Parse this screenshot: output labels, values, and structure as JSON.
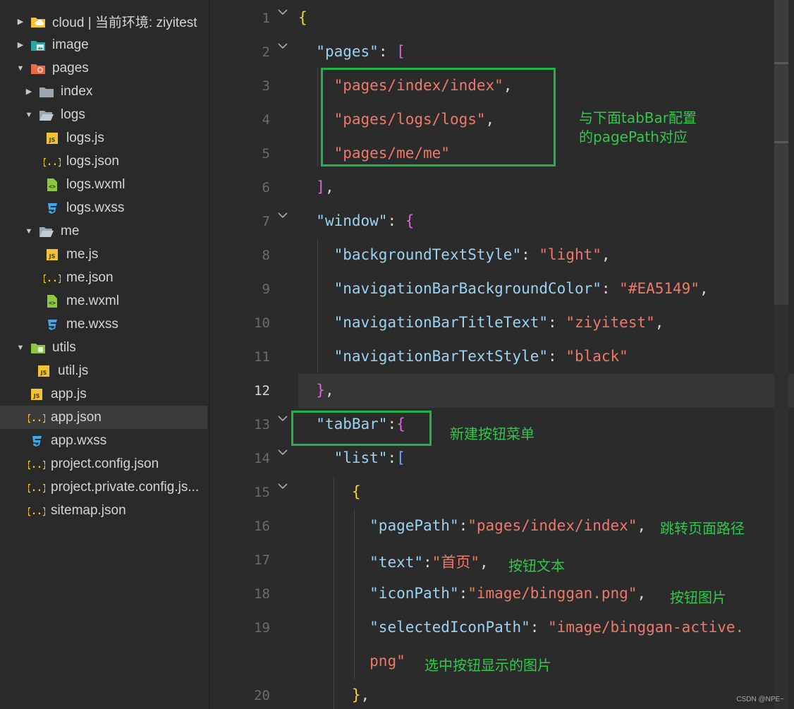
{
  "explorer": {
    "items": [
      {
        "label": "cloud | 当前环境: ziyitest",
        "icon": "cloud-folder-icon",
        "twisty": "▶"
      },
      {
        "label": "image",
        "icon": "image-folder-icon",
        "twisty": "▶"
      },
      {
        "label": "pages",
        "icon": "pages-folder-icon",
        "twisty": "▼"
      },
      {
        "label": "index",
        "icon": "folder-icon",
        "twisty": "▶"
      },
      {
        "label": "logs",
        "icon": "folder-open-icon",
        "twisty": "▼"
      },
      {
        "label": "logs.js",
        "icon": "js-file-icon",
        "twisty": ""
      },
      {
        "label": "logs.json",
        "icon": "json-file-icon",
        "twisty": ""
      },
      {
        "label": "logs.wxml",
        "icon": "wxml-file-icon",
        "twisty": ""
      },
      {
        "label": "logs.wxss",
        "icon": "wxss-file-icon",
        "twisty": ""
      },
      {
        "label": "me",
        "icon": "folder-open-icon",
        "twisty": "▼"
      },
      {
        "label": "me.js",
        "icon": "js-file-icon",
        "twisty": ""
      },
      {
        "label": "me.json",
        "icon": "json-file-icon",
        "twisty": ""
      },
      {
        "label": "me.wxml",
        "icon": "wxml-file-icon",
        "twisty": ""
      },
      {
        "label": "me.wxss",
        "icon": "wxss-file-icon",
        "twisty": ""
      },
      {
        "label": "utils",
        "icon": "utils-folder-icon",
        "twisty": "▼"
      },
      {
        "label": "util.js",
        "icon": "js-file-icon",
        "twisty": ""
      },
      {
        "label": "app.js",
        "icon": "js-file-icon",
        "twisty": ""
      },
      {
        "label": "app.json",
        "icon": "json-file-icon",
        "twisty": "",
        "selected": true
      },
      {
        "label": "app.wxss",
        "icon": "wxss-file-icon",
        "twisty": ""
      },
      {
        "label": "project.config.json",
        "icon": "json-file-icon",
        "twisty": ""
      },
      {
        "label": "project.private.config.js...",
        "icon": "json-file-icon",
        "twisty": ""
      },
      {
        "label": "sitemap.json",
        "icon": "json-file-icon",
        "twisty": ""
      }
    ]
  },
  "editor": {
    "active_line": "12",
    "line_numbers": [
      "1",
      "2",
      "3",
      "4",
      "5",
      "6",
      "7",
      "8",
      "9",
      "10",
      "11",
      "12",
      "13",
      "14",
      "15",
      "16",
      "17",
      "18",
      "19",
      "20"
    ],
    "lines": [
      {
        "id": "l1",
        "tokens": [
          {
            "t": "{",
            "c": "b1"
          }
        ]
      },
      {
        "id": "l2",
        "tokens": [
          {
            "t": "  "
          },
          {
            "t": "\"pages\"",
            "c": "k"
          },
          {
            "t": ": "
          },
          {
            "t": "[",
            "c": "b2"
          }
        ]
      },
      {
        "id": "l3",
        "tokens": [
          {
            "t": "    "
          },
          {
            "t": "\"pages/index/index\"",
            "c": "s"
          },
          {
            "t": ","
          }
        ]
      },
      {
        "id": "l4",
        "tokens": [
          {
            "t": "    "
          },
          {
            "t": "\"pages/logs/logs\"",
            "c": "s"
          },
          {
            "t": ","
          }
        ]
      },
      {
        "id": "l5",
        "tokens": [
          {
            "t": "    "
          },
          {
            "t": "\"pages/me/me\"",
            "c": "s"
          }
        ]
      },
      {
        "id": "l6",
        "tokens": [
          {
            "t": "  "
          },
          {
            "t": "]",
            "c": "b2"
          },
          {
            "t": ","
          }
        ]
      },
      {
        "id": "l7",
        "tokens": [
          {
            "t": "  "
          },
          {
            "t": "\"window\"",
            "c": "k"
          },
          {
            "t": ": "
          },
          {
            "t": "{",
            "c": "b2"
          }
        ]
      },
      {
        "id": "l8",
        "tokens": [
          {
            "t": "    "
          },
          {
            "t": "\"backgroundTextStyle\"",
            "c": "k"
          },
          {
            "t": ": "
          },
          {
            "t": "\"light\"",
            "c": "s"
          },
          {
            "t": ","
          }
        ]
      },
      {
        "id": "l9",
        "tokens": [
          {
            "t": "    "
          },
          {
            "t": "\"navigationBarBackgroundColor\"",
            "c": "k"
          },
          {
            "t": ": "
          },
          {
            "t": "\"#EA5149\"",
            "c": "s"
          },
          {
            "t": ","
          }
        ]
      },
      {
        "id": "l10",
        "tokens": [
          {
            "t": "    "
          },
          {
            "t": "\"navigationBarTitleText\"",
            "c": "k"
          },
          {
            "t": ": "
          },
          {
            "t": "\"ziyitest\"",
            "c": "s"
          },
          {
            "t": ","
          }
        ]
      },
      {
        "id": "l11",
        "tokens": [
          {
            "t": "    "
          },
          {
            "t": "\"navigationBarTextStyle\"",
            "c": "k"
          },
          {
            "t": ": "
          },
          {
            "t": "\"black\"",
            "c": "s"
          }
        ]
      },
      {
        "id": "l12",
        "tokens": [
          {
            "t": "  "
          },
          {
            "t": "}",
            "c": "b2"
          },
          {
            "t": ","
          }
        ]
      },
      {
        "id": "l13",
        "tokens": [
          {
            "t": "  "
          },
          {
            "t": "\"tabBar\"",
            "c": "k"
          },
          {
            "t": ":"
          },
          {
            "t": "{",
            "c": "b2"
          }
        ]
      },
      {
        "id": "l14",
        "tokens": [
          {
            "t": "    "
          },
          {
            "t": "\"list\"",
            "c": "k"
          },
          {
            "t": ":"
          },
          {
            "t": "[",
            "c": "b3"
          }
        ]
      },
      {
        "id": "l15",
        "tokens": [
          {
            "t": "      "
          },
          {
            "t": "{",
            "c": "b1"
          }
        ]
      },
      {
        "id": "l16",
        "tokens": [
          {
            "t": "        "
          },
          {
            "t": "\"pagePath\"",
            "c": "k"
          },
          {
            "t": ":"
          },
          {
            "t": "\"pages/index/index\"",
            "c": "s"
          },
          {
            "t": ","
          }
        ]
      },
      {
        "id": "l17",
        "tokens": [
          {
            "t": "        "
          },
          {
            "t": "\"text\"",
            "c": "k"
          },
          {
            "t": ":"
          },
          {
            "t": "\"",
            "c": "s"
          },
          {
            "t": "首页",
            "c": "cn"
          },
          {
            "t": "\"",
            "c": "s"
          },
          {
            "t": ","
          }
        ]
      },
      {
        "id": "l18",
        "tokens": [
          {
            "t": "        "
          },
          {
            "t": "\"iconPath\"",
            "c": "k"
          },
          {
            "t": ":"
          },
          {
            "t": "\"image/binggan.png\"",
            "c": "s"
          },
          {
            "t": ","
          }
        ]
      },
      {
        "id": "l19",
        "tokens": [
          {
            "t": "        "
          },
          {
            "t": "\"selectedIconPath\"",
            "c": "k"
          },
          {
            "t": ": "
          },
          {
            "t": "\"image/binggan-active.",
            "c": "s"
          }
        ]
      },
      {
        "id": "l19b",
        "tokens": [
          {
            "t": "        "
          },
          {
            "t": "png\"",
            "c": "s"
          }
        ]
      },
      {
        "id": "l20",
        "tokens": [
          {
            "t": "      "
          },
          {
            "t": "}",
            "c": "b1"
          },
          {
            "t": ","
          }
        ]
      }
    ],
    "annotations": {
      "pages_note_line1": "与下面tabBar配置",
      "pages_note_line2": "的pagePath对应",
      "tabbar_note": "新建按钮菜单",
      "pagepath_note": "跳转页面路径",
      "text_note": "按钮文本",
      "iconpath_note": "按钮图片",
      "selected_note": "选中按钮显示的图片"
    }
  },
  "watermark": "CSDN @NPE~",
  "colors": {
    "annotation_green": "#1fb34a",
    "string": "#f0786a",
    "key": "#9ad2f2"
  }
}
